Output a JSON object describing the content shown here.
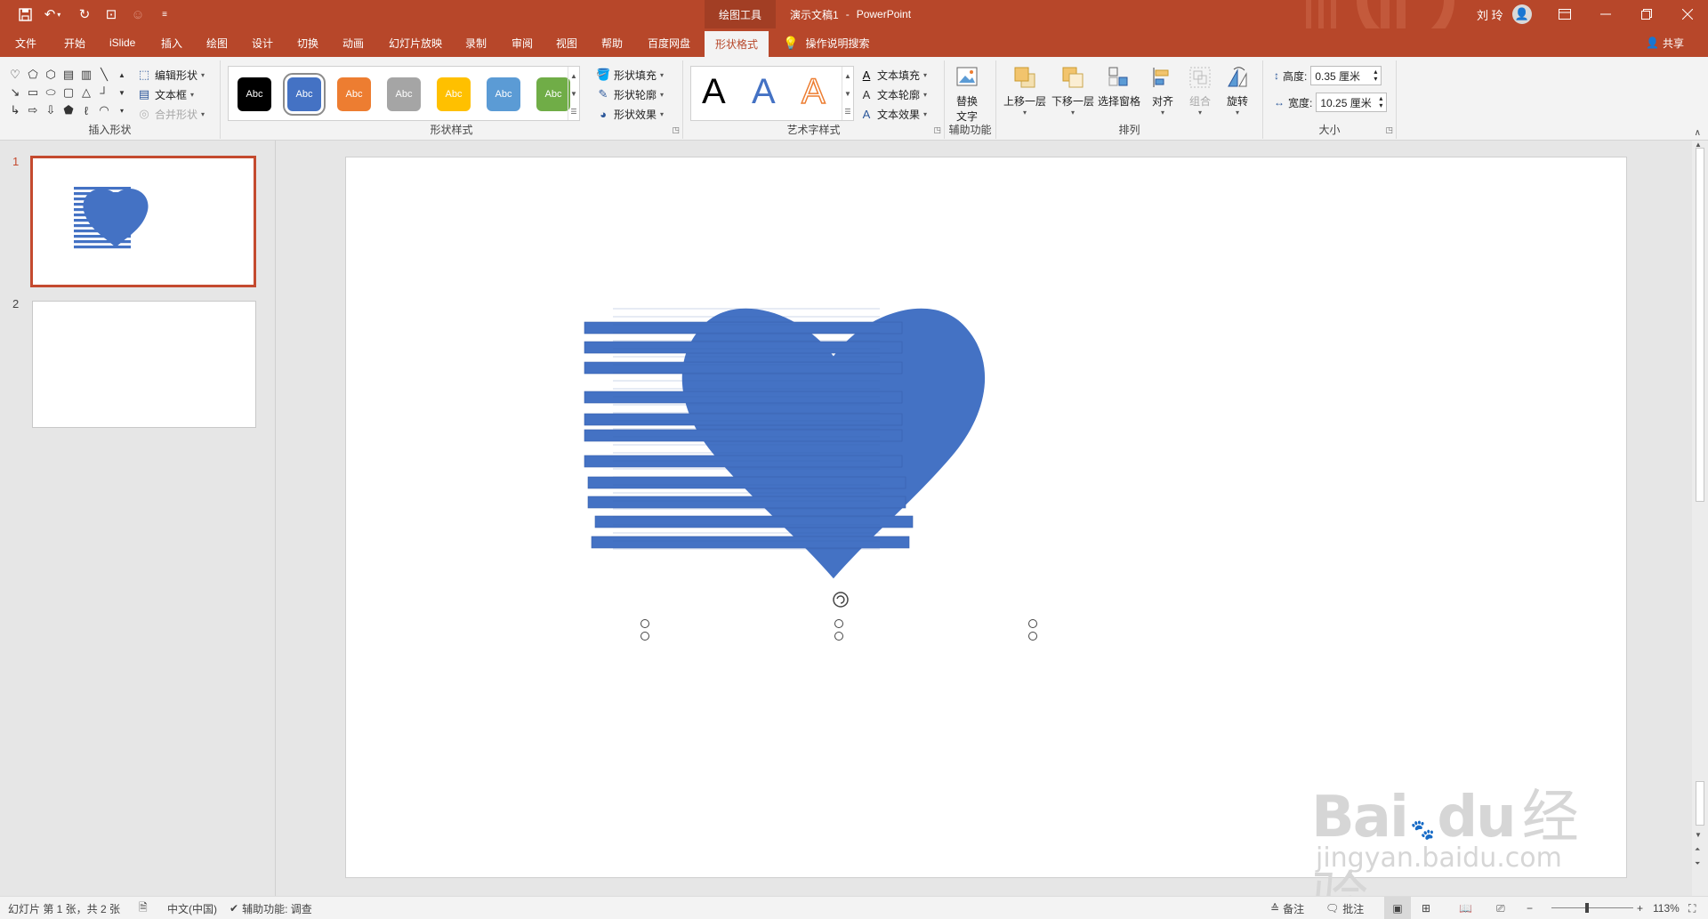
{
  "titlebar": {
    "context_tab": "绘图工具",
    "doc_name": "演示文稿1",
    "separator": "-",
    "app_name": "PowerPoint",
    "user": "刘 玲"
  },
  "tabs": [
    "文件",
    "开始",
    "iSlide",
    "插入",
    "绘图",
    "设计",
    "切换",
    "动画",
    "幻灯片放映",
    "录制",
    "审阅",
    "视图",
    "帮助",
    "百度网盘",
    "形状格式"
  ],
  "active_tab": "形状格式",
  "tell_me": "操作说明搜索",
  "share": "共享",
  "ribbon": {
    "insert_shapes": {
      "label": "插入形状",
      "edit_shape": "编辑形状",
      "text_box": "文本框",
      "merge_shapes": "合并形状"
    },
    "shape_styles": {
      "label": "形状样式",
      "swatch_text": "Abc",
      "swatches": [
        "#000000",
        "#4472c4",
        "#ed7d31",
        "#a5a5a5",
        "#ffc000",
        "#5b9bd5",
        "#70ad47"
      ],
      "fill": "形状填充",
      "outline": "形状轮廓",
      "effects": "形状效果"
    },
    "wordart": {
      "label": "艺术字样式",
      "letter": "A",
      "text_fill": "文本填充",
      "text_outline": "文本轮廓",
      "text_effects": "文本效果"
    },
    "accessibility": {
      "label": "辅助功能",
      "alt_text_line1": "替换",
      "alt_text_line2": "文字"
    },
    "arrange": {
      "label": "排列",
      "bring_forward": "上移一层",
      "send_backward": "下移一层",
      "selection_pane": "选择窗格",
      "align": "对齐",
      "group": "组合",
      "rotate": "旋转"
    },
    "size": {
      "label": "大小",
      "height_label": "高度:",
      "height_value": "0.35 厘米",
      "width_label": "宽度:",
      "width_value": "10.25 厘米"
    }
  },
  "thumbnails": [
    {
      "num": "1"
    },
    {
      "num": "2"
    }
  ],
  "slide": {
    "shape_color": "#4472c4"
  },
  "watermark": {
    "brand": "Bai",
    "brand2": "du",
    "cn": "经验",
    "url": "jingyan.baidu.com"
  },
  "status": {
    "slide_info": "幻灯片 第 1 张，共 2 张",
    "language": "中文(中国)",
    "accessibility": "辅助功能: 调查",
    "notes": "备注",
    "comments": "批注",
    "zoom": "113%"
  }
}
